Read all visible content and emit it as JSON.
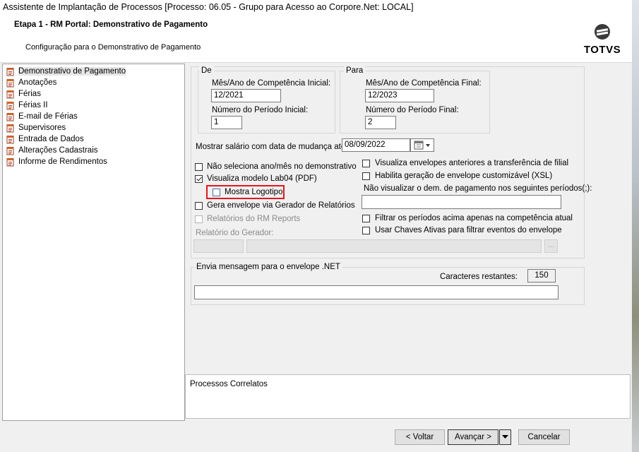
{
  "window": {
    "title": "Assistente de Implantação de Processos [Processo: 06.05 - Grupo para Acesso ao Corpore.Net: LOCAL]"
  },
  "header": {
    "stage_title": "Etapa 1 - RM Portal: Demonstrativo de Pagamento",
    "subtitle": "Configuração para o Demonstrativo de Pagamento",
    "logo_text": "TOTVS"
  },
  "tree": {
    "items": [
      {
        "label": "Demonstrativo de Pagamento",
        "selected": true
      },
      {
        "label": "Anotações"
      },
      {
        "label": "Férias"
      },
      {
        "label": "Férias II"
      },
      {
        "label": "E-mail de Férias"
      },
      {
        "label": "Supervisores"
      },
      {
        "label": "Entrada de Dados"
      },
      {
        "label": "Alterações Cadastrais"
      },
      {
        "label": "Informe de Rendimentos"
      }
    ]
  },
  "de": {
    "group": "De",
    "comp_label": "Mês/Ano de Competência Inicial:",
    "comp_value": "12/2021",
    "period_label": "Número do Período Inicial:",
    "period_value": "1"
  },
  "para": {
    "group": "Para",
    "comp_label": "Mês/Ano de Competência Final:",
    "comp_value": "12/2023",
    "period_label": "Número do Período Final:",
    "period_value": "2"
  },
  "salary": {
    "label": "Mostrar salário com data de mudança até:",
    "value": "08/09/2022"
  },
  "options_left": [
    {
      "label": "Não seleciona ano/mês no demonstrativo",
      "checked": false
    },
    {
      "label": "Visualiza modelo Lab04 (PDF)",
      "checked": true
    },
    {
      "label": "Mostra Logotipo",
      "checked": false
    },
    {
      "label": "Gera envelope via Gerador de Relatórios",
      "checked": false
    },
    {
      "label": "Relatórios do RM Reports",
      "checked": false
    }
  ],
  "gerador_label": "Relatório do Gerador:",
  "browse_label": "...",
  "options_right": [
    {
      "label": "Visualiza envelopes anteriores a transferência de filial",
      "checked": false
    },
    {
      "label": "Habilita geração de envelope customizável (XSL)",
      "checked": false
    }
  ],
  "periods_label": "Não visualizar o dem. de pagamento nos seguintes períodos(;):",
  "periods_value": "",
  "options_right2": [
    {
      "label": "Filtrar os períodos acima apenas na competência atual",
      "checked": false
    },
    {
      "label": "Usar Chaves Ativas para filtrar eventos do envelope",
      "checked": false
    }
  ],
  "message": {
    "group": "Envia mensagem para o envelope .NET",
    "remaining_label": "Caracteres restantes:",
    "remaining_value": "150",
    "value": ""
  },
  "correlatos": {
    "label": "Processos Correlatos"
  },
  "buttons": {
    "back": "< Voltar",
    "next": "Avançar >",
    "cancel": "Cancelar"
  }
}
